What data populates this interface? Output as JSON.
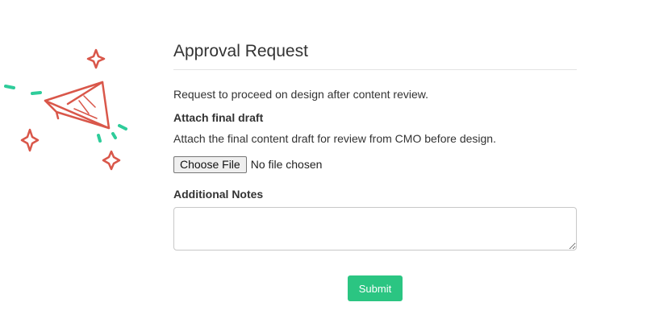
{
  "form": {
    "title": "Approval Request",
    "description": "Request to proceed on design after content review.",
    "attach_label": "Attach final draft",
    "attach_help": "Attach the final content draft for review from CMO before design.",
    "file_button_label": "Choose File",
    "file_status": "No file chosen",
    "notes_label": "Additional Notes",
    "notes_value": "",
    "submit_label": "Submit"
  },
  "illustration": {
    "icon": "paper-plane-icon",
    "plane_color": "#d9574a",
    "sparkle_color": "#d9574a",
    "motion_color": "#2ecc9a"
  },
  "colors": {
    "accent": "#2bc582",
    "text": "#333333",
    "divider": "#e3e3e3"
  }
}
